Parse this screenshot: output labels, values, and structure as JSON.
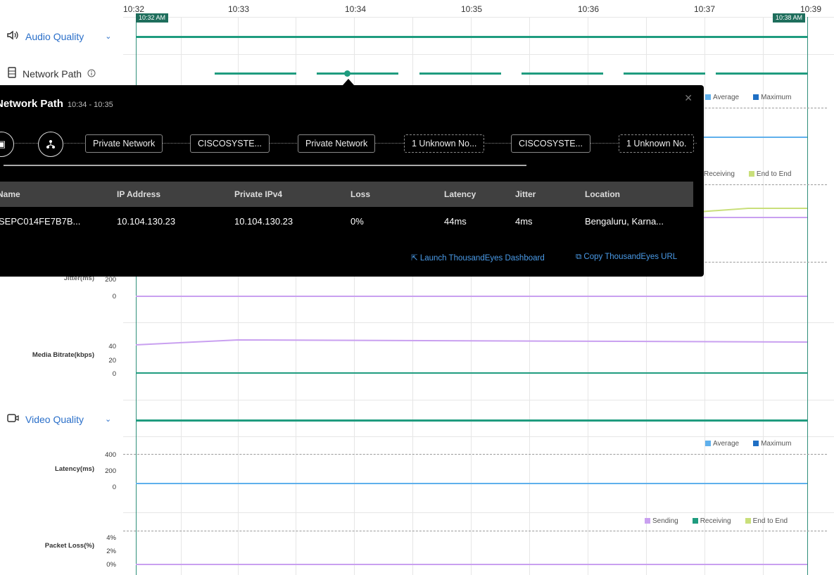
{
  "timeline": {
    "ticks": [
      "10:32",
      "10:33",
      "10:34",
      "10:35",
      "10:36",
      "10:37",
      "10:39"
    ],
    "start_marker": "10:32 AM",
    "end_marker": "10:38 AM"
  },
  "sections": {
    "audio": {
      "label": "Audio Quality",
      "icon": "speaker-icon",
      "expanded": true
    },
    "network_path": {
      "label": "Network Path",
      "icon": "server-icon"
    },
    "video": {
      "label": "Video Quality",
      "icon": "video-camera-icon",
      "expanded": true
    }
  },
  "audio_rows": {
    "jitter_label": "Jitter(ms)",
    "jitter_ticks": [
      "200",
      "0"
    ],
    "bitrate_label": "Media Bitrate(kbps)",
    "bitrate_ticks": [
      "40",
      "20",
      "0"
    ]
  },
  "video_rows": {
    "latency_label": "Latency(ms)",
    "latency_ticks": [
      "400",
      "200",
      "0"
    ],
    "loss_label": "Packet Loss(%)",
    "loss_ticks": [
      "4%",
      "2%",
      "0%"
    ]
  },
  "legends": {
    "average": "Average",
    "maximum": "Maximum",
    "sending": "Sending",
    "receiving": "Receiving",
    "end_to_end": "End to End"
  },
  "colors": {
    "average": "#5fb0ec",
    "maximum": "#1f6fc4",
    "sending": "#c9a0f0",
    "receiving": "#1f9c7f",
    "end_to_end": "#c9df7a",
    "marker": "#1e6e5c"
  },
  "popup": {
    "title": "Network Path",
    "time_range": "10:34 - 10:35",
    "nodes": [
      "Private Network",
      "CISCOSYSTE...",
      "Private Network",
      "1 Unknown No...",
      "CISCOSYSTE...",
      "1 Unknown No."
    ],
    "columns": [
      "Name",
      "IP Address",
      "Private IPv4",
      "Loss",
      "Latency",
      "Jitter",
      "Location"
    ],
    "row": [
      "SEPC014FE7B7B...",
      "10.104.130.23",
      "10.104.130.23",
      "0%",
      "44ms",
      "4ms",
      "Bengaluru, Karna..."
    ],
    "launch_link": "Launch ThousandEyes Dashboard",
    "copy_link": "Copy ThousandEyes URL"
  }
}
